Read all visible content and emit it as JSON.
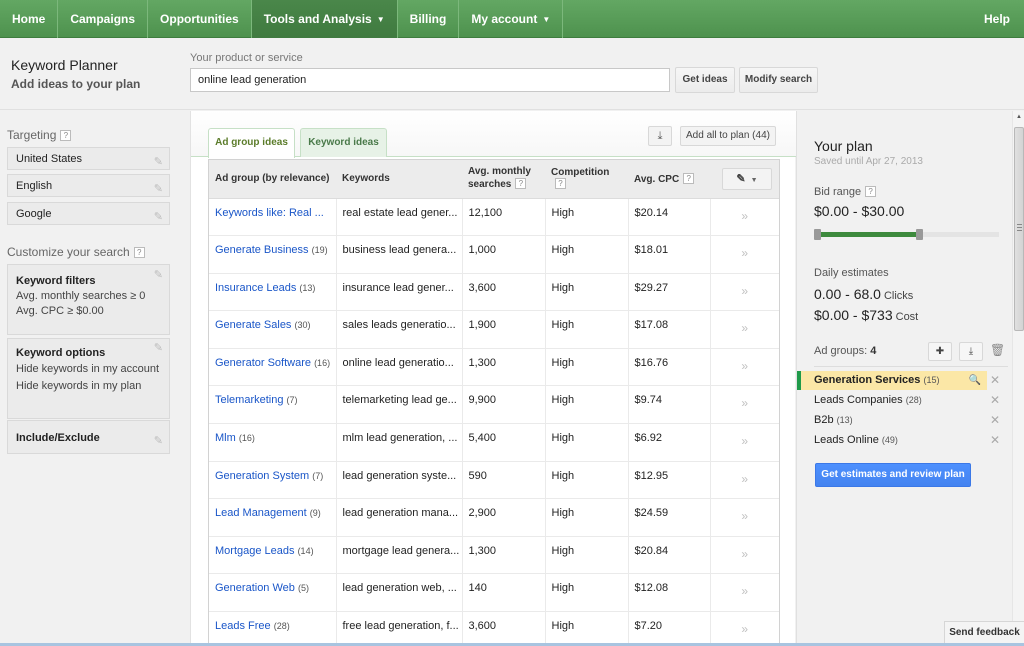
{
  "nav": {
    "items": [
      {
        "label": "Home",
        "active": false,
        "dropdown": false
      },
      {
        "label": "Campaigns",
        "active": false,
        "dropdown": false
      },
      {
        "label": "Opportunities",
        "active": false,
        "dropdown": false
      },
      {
        "label": "Tools and Analysis",
        "active": true,
        "dropdown": true
      },
      {
        "label": "Billing",
        "active": false,
        "dropdown": false
      },
      {
        "label": "My account",
        "active": false,
        "dropdown": true
      }
    ],
    "help": "Help"
  },
  "header": {
    "title": "Keyword Planner",
    "subtitle": "Add ideas to your plan",
    "search_label": "Your product or service",
    "search_value": "online lead generation",
    "get_ideas": "Get ideas",
    "modify_search": "Modify search"
  },
  "sidebar": {
    "targeting_label": "Targeting",
    "targeting": [
      "United States",
      "English",
      "Google"
    ],
    "customize_label": "Customize your search",
    "keyword_filters": {
      "title": "Keyword filters",
      "lines": [
        "Avg. monthly searches ≥ 0",
        "Avg. CPC ≥ $0.00"
      ]
    },
    "keyword_options": {
      "title": "Keyword options",
      "lines": [
        "Hide keywords in my account",
        "Hide keywords in my plan"
      ]
    },
    "include_exclude": {
      "title": "Include/Exclude"
    }
  },
  "main": {
    "tabs": [
      {
        "label": "Ad group ideas",
        "active": true
      },
      {
        "label": "Keyword ideas",
        "active": false
      }
    ],
    "add_all": "Add all to plan (44)",
    "columns": {
      "ad_group": "Ad group (by relevance)",
      "keywords": "Keywords",
      "searches": "Avg. monthly searches",
      "competition": "Competition",
      "cpc": "Avg. CPC"
    },
    "rows": [
      {
        "name": "Keywords like: Real ...",
        "count": "",
        "keywords": "real estate lead gener...",
        "searches": "12,100",
        "competition": "High",
        "cpc": "$20.14"
      },
      {
        "name": "Generate Business",
        "count": "(19)",
        "keywords": "business lead genera...",
        "searches": "1,000",
        "competition": "High",
        "cpc": "$18.01"
      },
      {
        "name": "Insurance Leads",
        "count": "(13)",
        "keywords": "insurance lead gener...",
        "searches": "3,600",
        "competition": "High",
        "cpc": "$29.27"
      },
      {
        "name": "Generate Sales",
        "count": "(30)",
        "keywords": "sales leads generatio...",
        "searches": "1,900",
        "competition": "High",
        "cpc": "$17.08"
      },
      {
        "name": "Generator Software",
        "count": "(16)",
        "keywords": "online lead generatio...",
        "searches": "1,300",
        "competition": "High",
        "cpc": "$16.76"
      },
      {
        "name": "Telemarketing",
        "count": "(7)",
        "keywords": "telemarketing lead ge...",
        "searches": "9,900",
        "competition": "High",
        "cpc": "$9.74"
      },
      {
        "name": "Mlm",
        "count": "(16)",
        "keywords": "mlm lead generation, ...",
        "searches": "5,400",
        "competition": "High",
        "cpc": "$6.92"
      },
      {
        "name": "Generation System",
        "count": "(7)",
        "keywords": "lead generation syste...",
        "searches": "590",
        "competition": "High",
        "cpc": "$12.95"
      },
      {
        "name": "Lead Management",
        "count": "(9)",
        "keywords": "lead generation mana...",
        "searches": "2,900",
        "competition": "High",
        "cpc": "$24.59"
      },
      {
        "name": "Mortgage Leads",
        "count": "(14)",
        "keywords": "mortgage lead genera...",
        "searches": "1,300",
        "competition": "High",
        "cpc": "$20.84"
      },
      {
        "name": "Generation Web",
        "count": "(5)",
        "keywords": "lead generation web, ...",
        "searches": "140",
        "competition": "High",
        "cpc": "$12.08"
      },
      {
        "name": "Leads Free",
        "count": "(28)",
        "keywords": "free lead generation, f...",
        "searches": "3,600",
        "competition": "High",
        "cpc": "$7.20"
      }
    ]
  },
  "plan": {
    "title": "Your plan",
    "saved": "Saved until Apr 27, 2013",
    "bid_label": "Bid range",
    "bid_range": "$0.00 - $30.00",
    "bid_slider_fraction": 0.55,
    "daily_label": "Daily estimates",
    "clicks_value": "0.00 - 68.0",
    "clicks_unit": "Clicks",
    "cost_value": "$0.00 - $733",
    "cost_unit": "Cost",
    "ad_groups_label": "Ad groups:",
    "ad_groups_count": "4",
    "ad_groups": [
      {
        "name": "Generation Services",
        "count": "(15)",
        "selected": true
      },
      {
        "name": "Leads Companies",
        "count": "(28)",
        "selected": false
      },
      {
        "name": "B2b",
        "count": "(13)",
        "selected": false
      },
      {
        "name": "Leads Online",
        "count": "(49)",
        "selected": false
      }
    ],
    "review_button": "Get estimates and review plan"
  },
  "feedback": "Send feedback",
  "colors": {
    "nav_green": "#5a9e5a",
    "link_blue": "#1a56c8",
    "primary_button": "#4d90fe",
    "selected_highlight": "#fbe7a6",
    "slider_fill": "#3d8a3d"
  }
}
